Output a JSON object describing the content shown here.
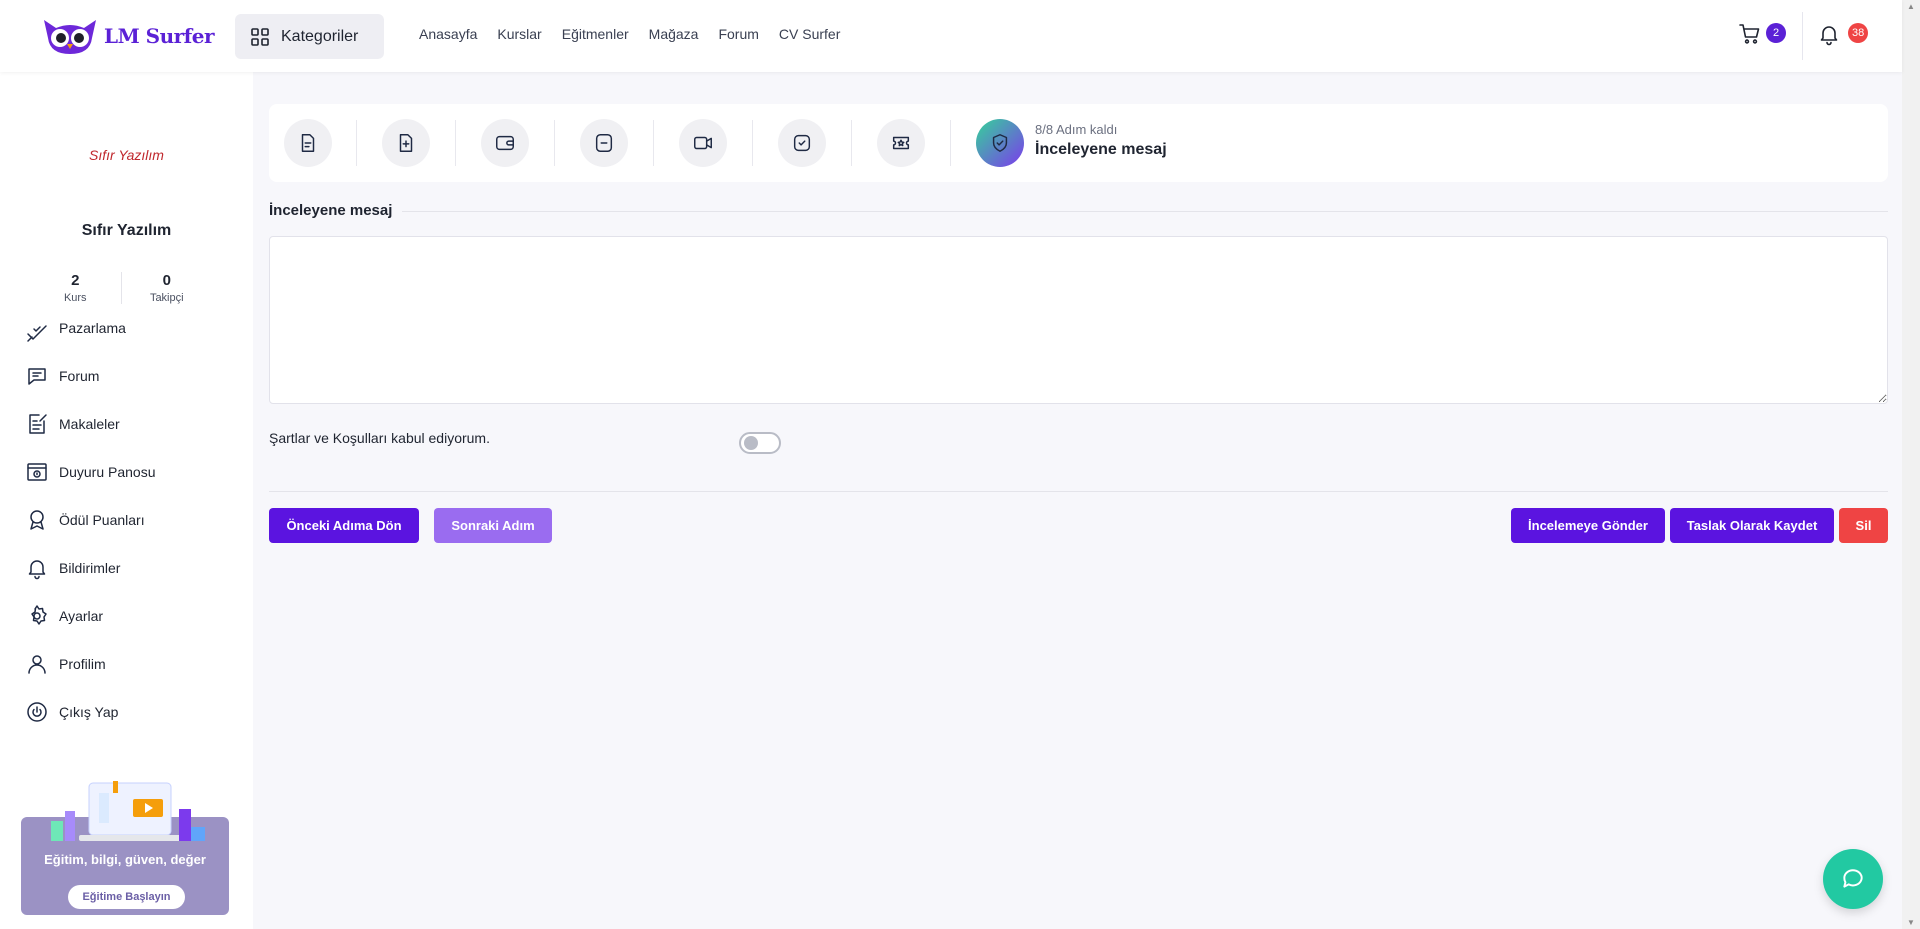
{
  "header": {
    "brand": "LM Surfer",
    "categories_label": "Kategoriler",
    "nav": [
      "Anasayfa",
      "Kurslar",
      "Eğitmenler",
      "Mağaza",
      "Forum",
      "CV Surfer"
    ],
    "cart_count": "2",
    "notification_count": "38"
  },
  "sidebar": {
    "logo_text": "Sıfır Yazılım",
    "name": "Sıfır Yazılım",
    "stats": [
      {
        "value": "2",
        "label": "Kurs"
      },
      {
        "value": "0",
        "label": "Takipçi"
      }
    ],
    "menu": [
      {
        "label": "Pazarlama",
        "icon": "marketing-icon"
      },
      {
        "label": "Forum",
        "icon": "forum-icon"
      },
      {
        "label": "Makaleler",
        "icon": "article-icon"
      },
      {
        "label": "Duyuru Panosu",
        "icon": "announcement-icon"
      },
      {
        "label": "Ödül Puanları",
        "icon": "award-icon"
      },
      {
        "label": "Bildirimler",
        "icon": "bell-icon"
      },
      {
        "label": "Ayarlar",
        "icon": "gear-icon"
      },
      {
        "label": "Profilim",
        "icon": "user-icon"
      },
      {
        "label": "Çıkış Yap",
        "icon": "power-icon"
      }
    ],
    "promo": {
      "title": "Eğitim, bilgi, güven, değer",
      "button": "Eğitime Başlayın"
    }
  },
  "stepper": {
    "steps": [
      "document-icon",
      "file-plus-icon",
      "wallet-icon",
      "folder-minus-icon",
      "video-icon",
      "check-square-icon",
      "ticket-star-icon"
    ],
    "active_icon": "shield-check-icon",
    "remaining": "8/8 Adım kaldı",
    "current": "İnceleyene mesaj"
  },
  "form": {
    "section_title": "İnceleyene mesaj",
    "message_value": "",
    "terms_label": "Şartlar ve Koşulları kabul ediyorum.",
    "terms_accepted": false
  },
  "actions": {
    "prev": "Önceki Adıma Dön",
    "next": "Sonraki Adım",
    "submit_review": "İncelemeye Gönder",
    "save_draft": "Taslak Olarak Kaydet",
    "delete": "Sil"
  },
  "colors": {
    "primary": "#5b14e0",
    "primary_light": "#9a6cf0",
    "danger": "#ef4444",
    "chat": "#22c9a2"
  }
}
